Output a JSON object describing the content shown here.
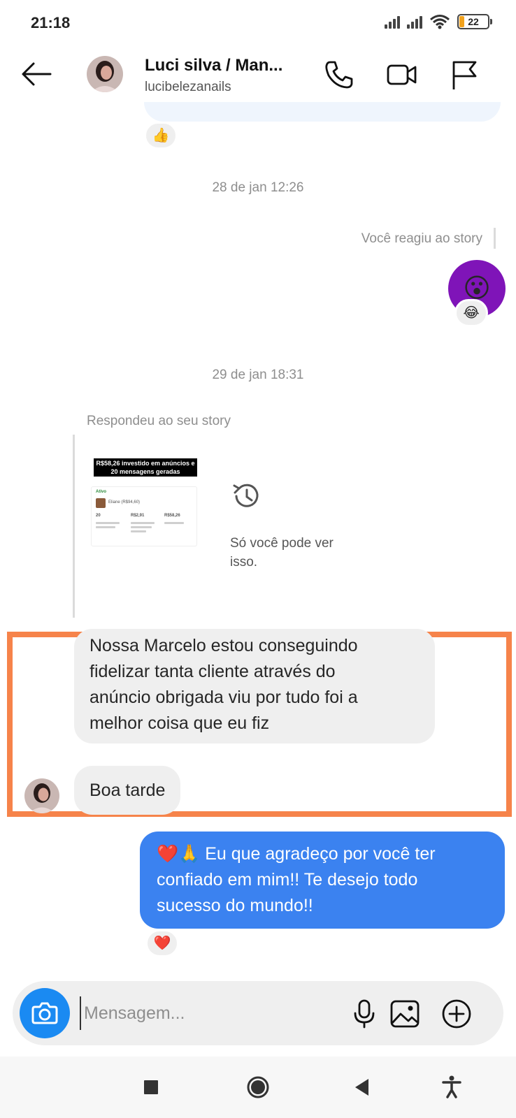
{
  "status_bar": {
    "time": "21:18",
    "battery": "22"
  },
  "header": {
    "contact_name": "Luci silva / Man...",
    "username": "lucibelezanails",
    "icons": [
      "back-arrow-icon",
      "phone-icon",
      "video-camera-icon",
      "flag-icon"
    ]
  },
  "chat": {
    "top_reaction": "👍",
    "timestamp_1": "28 de jan 12:26",
    "reacted_label": "Você reagiu ao story",
    "story_reaction_emoji": "😮",
    "story_reaction_badge": "😂",
    "timestamp_2": "29 de jan 18:31",
    "replied_label": "Respondeu ao seu story",
    "story_preview": {
      "caption": "R$58,26 investido em anúncios e 20 mensagens geradas",
      "card_title": "Ativo",
      "card_name": "Eliane (R$94,60)",
      "stats": [
        "20",
        "R$2,91",
        "R$58,26"
      ]
    },
    "only_you_text": "Só você pode ver isso.",
    "incoming_messages": [
      {
        "text_lines": [
          "Nossa Marcelo estou conseguindo",
          "fidelizar tanta cliente através do",
          "anúncio obrigada viu por tudo foi a",
          "melhor coisa que eu fiz"
        ]
      },
      {
        "text": "Boa tarde"
      }
    ],
    "outgoing_message": {
      "text_lines": [
        "❤️🙏 Eu que agradeço por você ter",
        "confiado em mim!! Te desejo todo",
        "sucesso do mundo!!"
      ]
    },
    "outgoing_reaction": "❤️"
  },
  "composer": {
    "placeholder": "Mensagem...",
    "icons": [
      "camera-icon",
      "microphone-icon",
      "gallery-icon",
      "plus-circle-icon"
    ]
  },
  "colors": {
    "accent_blue": "#3b82f0",
    "camera_blue": "#1a8af2",
    "incoming_bubble": "#efefef",
    "highlight_orange": "#f6834a",
    "story_purple": "#7f14b8"
  }
}
